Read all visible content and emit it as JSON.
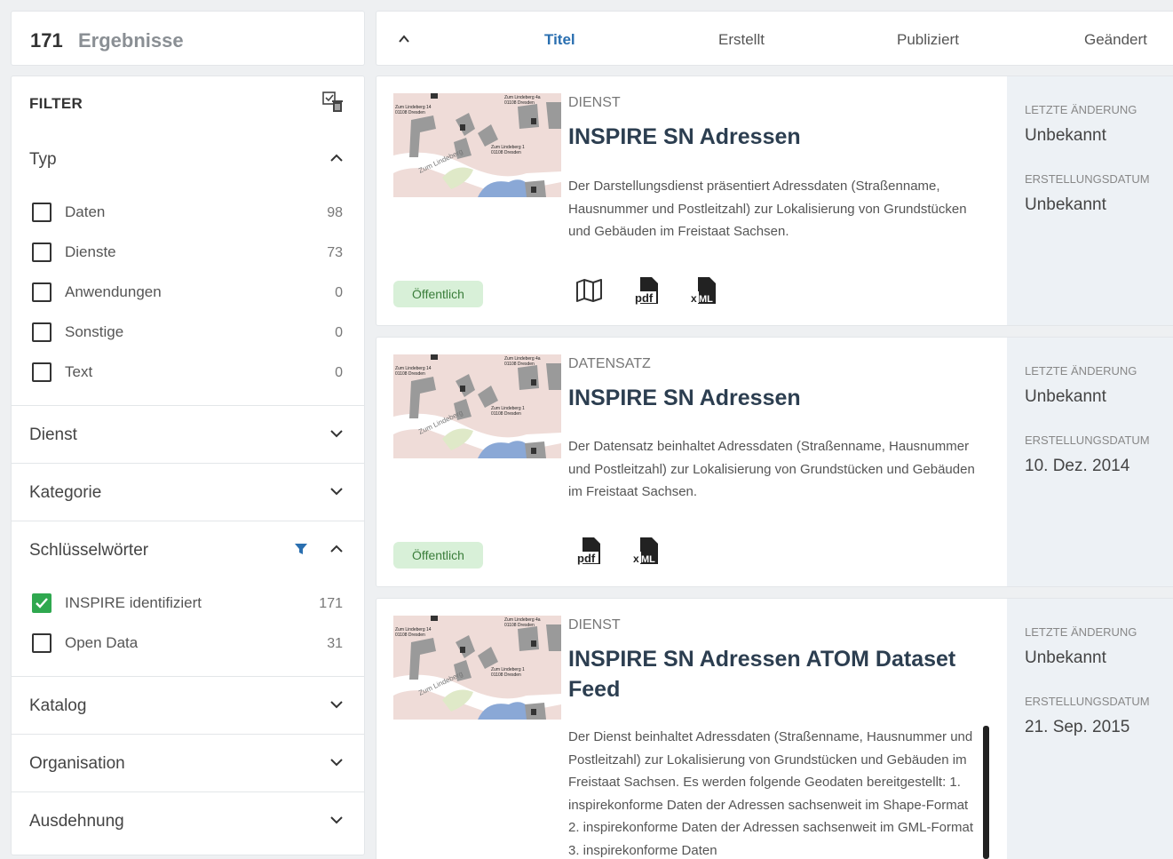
{
  "results": {
    "count": "171",
    "label": "Ergebnisse"
  },
  "filter": {
    "heading": "FILTER",
    "typ": {
      "title": "Typ",
      "options": [
        {
          "label": "Daten",
          "count": "98"
        },
        {
          "label": "Dienste",
          "count": "73"
        },
        {
          "label": "Anwendungen",
          "count": "0"
        },
        {
          "label": "Sonstige",
          "count": "0"
        },
        {
          "label": "Text",
          "count": "0"
        }
      ]
    },
    "sections": [
      "Dienst",
      "Kategorie",
      "Schlüsselwörter",
      "Katalog",
      "Organisation",
      "Ausdehnung"
    ],
    "keywords": [
      {
        "label": "INSPIRE identifiziert",
        "count": "171",
        "checked": true
      },
      {
        "label": "Open Data",
        "count": "31",
        "checked": false
      }
    ]
  },
  "sort": {
    "items": [
      "Titel",
      "Erstellt",
      "Publiziert",
      "Geändert"
    ],
    "active": "Titel"
  },
  "cards": [
    {
      "kind": "DIENST",
      "title": "INSPIRE SN Adressen",
      "description": "Der Darstellungsdienst präsentiert Adressdaten (Straßenname, Hausnummer und Postleitzahl) zur Lokalisierung von Grundstücken und Gebäuden im Freistaat Sachsen.",
      "badge": "Öffentlich",
      "icons": [
        "map-icon",
        "pdf-icon",
        "xml-icon"
      ],
      "meta": [
        {
          "label": "LETZTE ÄNDERUNG",
          "value": "Unbekannt"
        },
        {
          "label": "ERSTELLUNGSDATUM",
          "value": "Unbekannt"
        }
      ]
    },
    {
      "kind": "DATENSATZ",
      "title": "INSPIRE SN Adressen",
      "description": "Der Datensatz beinhaltet Adressdaten (Straßenname, Hausnummer und Postleitzahl) zur Lokalisierung von Grundstücken und Gebäuden im Freistaat Sachsen.",
      "badge": "Öffentlich",
      "icons": [
        "pdf-icon",
        "xml-icon"
      ],
      "meta": [
        {
          "label": "LETZTE ÄNDERUNG",
          "value": "Unbekannt"
        },
        {
          "label": "ERSTELLUNGSDATUM",
          "value": "10. Dez. 2014"
        }
      ]
    },
    {
      "kind": "DIENST",
      "title": "INSPIRE SN Adressen ATOM Dataset Feed",
      "description": "Der Dienst beinhaltet Adressdaten (Straßenname, Hausnummer und Postleitzahl) zur Lokalisierung von Grundstücken und Gebäuden im Freistaat Sachsen. Es werden folgende Geodaten bereitgestellt: 1. inspirekonforme Daten der Adressen sachsenweit im Shape-Format 2. inspirekonforme Daten der Adressen sachsenweit im GML-Format 3. inspirekonforme Daten",
      "meta": [
        {
          "label": "LETZTE ÄNDERUNG",
          "value": "Unbekannt"
        },
        {
          "label": "ERSTELLUNGSDATUM",
          "value": "21. Sep. 2015"
        }
      ]
    }
  ],
  "thumbnail_text": [
    "Zum Lindeberg 14",
    "01108 Dresden",
    "Zum Lindeberg 4a",
    "01108 Dresden",
    "Zum Lindeberg 1",
    "01108 Dresden",
    "Zum Lindeberg"
  ],
  "colors": {
    "accent": "#2a6fb0",
    "check": "#2fa84f",
    "badge_bg": "#d8f0d8",
    "badge_text": "#3a7d3a",
    "side_bg": "#edf1f5"
  }
}
